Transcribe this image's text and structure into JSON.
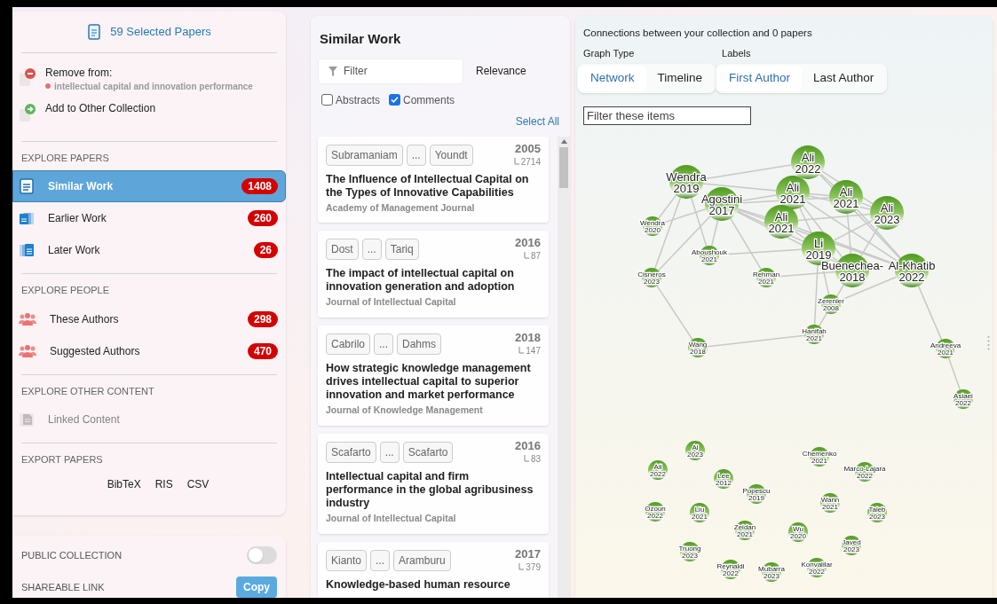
{
  "sidebar": {
    "header": {
      "label": "59 Selected Papers"
    },
    "actions": [
      {
        "kind": "remove",
        "label": "Remove from:",
        "collection": {
          "name": "intellectual capital and innovation performance",
          "color": "#e57373"
        }
      },
      {
        "kind": "add",
        "label": "Add to Other Collection"
      }
    ],
    "sections": [
      {
        "title": "EXPLORE PAPERS",
        "items": [
          {
            "kind": "doc",
            "label": "Similar Work",
            "count": "1408",
            "selected": true,
            "disabled": false
          },
          {
            "kind": "earlier",
            "label": "Earlier Work",
            "count": "260",
            "selected": false,
            "disabled": false
          },
          {
            "kind": "later",
            "label": "Later Work",
            "count": "26",
            "selected": false,
            "disabled": false
          }
        ]
      },
      {
        "title": "EXPLORE PEOPLE",
        "items": [
          {
            "kind": "people",
            "label": "These Authors",
            "count": "298",
            "selected": false,
            "disabled": false
          },
          {
            "kind": "people",
            "label": "Suggested Authors",
            "count": "470",
            "selected": false,
            "disabled": false
          }
        ]
      },
      {
        "title": "EXPLORE OTHER CONTENT",
        "items": [
          {
            "kind": "linked",
            "label": "Linked Content",
            "selected": false,
            "disabled": true
          }
        ]
      },
      {
        "title": "EXPORT PAPERS",
        "exports": [
          "BibTeX",
          "RIS",
          "CSV"
        ]
      }
    ]
  },
  "settings": [
    {
      "kind": "toggle",
      "label": "PUBLIC COLLECTION",
      "on": false
    },
    {
      "kind": "button",
      "label": "SHAREABLE LINK",
      "button": "Copy"
    }
  ],
  "list": {
    "title": "Similar Work",
    "filter": {
      "placeholder": "Filter"
    },
    "sort": "Relevance",
    "options": [
      {
        "label": "Abstracts",
        "checked": false
      },
      {
        "label": "Comments",
        "checked": true
      }
    ],
    "select_all": "Select All",
    "papers": [
      {
        "first_author": "Subramaniam",
        "more": "...",
        "last_author": "Youndt",
        "year": "2005",
        "citations": "2714",
        "title": "The Influence of Intellectual Capital on the Types of Innovative Capabilities",
        "journal": "Academy of Management Journal"
      },
      {
        "first_author": "Dost",
        "more": "...",
        "last_author": "Tariq",
        "year": "2016",
        "citations": "87",
        "title": "The impact of intellectual capital on innovation generation and adoption",
        "journal": "Journal of Intellectual Capital"
      },
      {
        "first_author": "Cabrilo",
        "more": "...",
        "last_author": "Dahms",
        "year": "2018",
        "citations": "147",
        "title": "How strategic knowledge management drives intellectual capital to superior innovation and market performance",
        "journal": "Journal of Knowledge Management"
      },
      {
        "first_author": "Scafarto",
        "more": "...",
        "last_author": "Scafarto",
        "year": "2016",
        "citations": "83",
        "title": "Intellectual capital and firm performance in the global agribusiness industry",
        "journal": "Journal of Intellectual Capital"
      },
      {
        "first_author": "Kianto",
        "more": "...",
        "last_author": "Aramburu",
        "year": "2017",
        "citations": "379",
        "title": "Knowledge-based human resource"
      }
    ]
  },
  "graph": {
    "caption": "Connections between your collection and 0 papers",
    "graph_type": {
      "label": "Graph Type",
      "options": [
        {
          "label": "Network",
          "selected": true
        },
        {
          "label": "Timeline",
          "selected": false
        }
      ]
    },
    "labels": {
      "label": "Labels",
      "options": [
        {
          "label": "First Author",
          "selected": true
        },
        {
          "label": "Last Author",
          "selected": false
        }
      ]
    },
    "filter": {
      "placeholder": "Filter these items"
    },
    "nodes": [
      {
        "name": "Ali",
        "year": "2022",
        "kind": "large"
      },
      {
        "name": "Wendra",
        "year": "2019",
        "kind": "large"
      },
      {
        "name": "Agostini",
        "year": "2017",
        "kind": "large"
      },
      {
        "name": "Ali",
        "year": "2021",
        "kind": "large"
      },
      {
        "name": "Ali",
        "year": "2021",
        "kind": "large"
      },
      {
        "name": "Ali",
        "year": "2023",
        "kind": "large"
      },
      {
        "name": "Ali",
        "year": "2021",
        "kind": "large"
      },
      {
        "name": "Li",
        "year": "2019",
        "kind": "large"
      },
      {
        "name": "Buenechea-",
        "year": "2018",
        "kind": "large"
      },
      {
        "name": "Al-Khatib",
        "year": "2022",
        "kind": "large"
      },
      {
        "name": "Wendra",
        "year": "2020",
        "kind": "small"
      },
      {
        "name": "Aboushouk",
        "year": "2021",
        "kind": "small"
      },
      {
        "name": "Cisneros",
        "year": "2023",
        "kind": "small"
      },
      {
        "name": "Rehman",
        "year": "2021",
        "kind": "small"
      },
      {
        "name": "Zerenler",
        "year": "2008",
        "kind": "small"
      },
      {
        "name": "Hanifah",
        "year": "2021",
        "kind": "small"
      },
      {
        "name": "Wang",
        "year": "2018",
        "kind": "small"
      },
      {
        "name": "Andreeva",
        "year": "2021",
        "kind": "small"
      },
      {
        "name": "Asiaei",
        "year": "2022",
        "kind": "small"
      },
      {
        "name": "Al",
        "year": "2023",
        "kind": "small"
      },
      {
        "name": "Ali",
        "year": "2022",
        "kind": "small"
      },
      {
        "name": "Lee",
        "year": "2012",
        "kind": "small"
      },
      {
        "name": "Chemenko",
        "year": "2021",
        "kind": "small"
      },
      {
        "name": "Marco-Lajara",
        "year": "2022",
        "kind": "small"
      },
      {
        "name": "Popescu",
        "year": "2019",
        "kind": "small"
      },
      {
        "name": "Wann",
        "year": "2021",
        "kind": "small"
      },
      {
        "name": "Ozoun",
        "year": "2022",
        "kind": "small"
      },
      {
        "name": "Liu",
        "year": "2021",
        "kind": "small"
      },
      {
        "name": "Taleb",
        "year": "2023",
        "kind": "small"
      },
      {
        "name": "Zeidan",
        "year": "2021",
        "kind": "small"
      },
      {
        "name": "Wu",
        "year": "2020",
        "kind": "small"
      },
      {
        "name": "Javed",
        "year": "2023",
        "kind": "small"
      },
      {
        "name": "Truong",
        "year": "2023",
        "kind": "small"
      },
      {
        "name": "Reynaldi",
        "year": "2022",
        "kind": "small"
      },
      {
        "name": "Mubarra",
        "year": "2023",
        "kind": "small"
      },
      {
        "name": "Konvalilar",
        "year": "2022",
        "kind": "small"
      }
    ]
  }
}
